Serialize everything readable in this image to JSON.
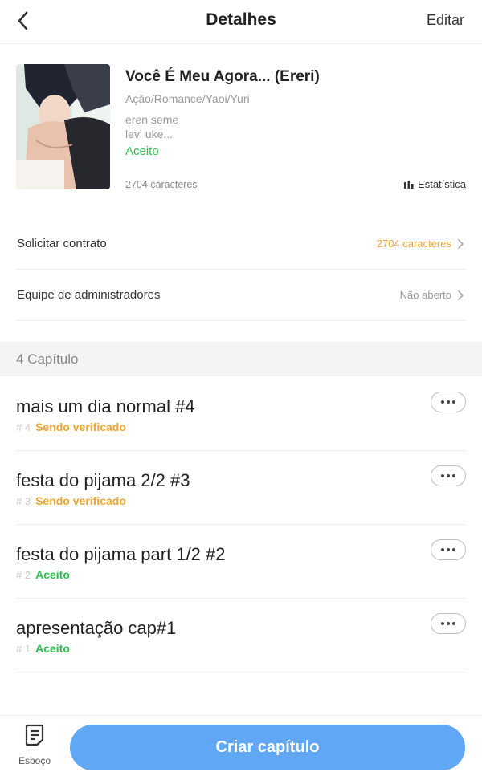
{
  "header": {
    "title": "Detalhes",
    "edit_label": "Editar"
  },
  "story": {
    "title": "Você É Meu Agora... (Ereri)",
    "genres": "Ação/Romance/Yaoi/Yuri",
    "desc_line1": "eren seme",
    "desc_line2": "levi uke...",
    "status": "Aceito",
    "chars": "2704 caracteres",
    "stats_label": "Estatística"
  },
  "rows": {
    "contract": {
      "label": "Solicitar contrato",
      "value": "2704 caracteres"
    },
    "admins": {
      "label": "Equipe de administradores",
      "value": "Não aberto"
    }
  },
  "chapters_header": "4 Capítulo",
  "chapters": [
    {
      "title": "mais um dia normal #4",
      "num": "# 4",
      "status": "Sendo verificado"
    },
    {
      "title": "festa do pijama 2/2 #3",
      "num": "# 3",
      "status": "Sendo verificado"
    },
    {
      "title": "festa do pijama part 1/2 #2",
      "num": "# 2",
      "status": "Aceito"
    },
    {
      "title": "apresentação cap#1",
      "num": "# 1",
      "status": "Aceito"
    }
  ],
  "bottom": {
    "draft_label": "Esboço",
    "create_label": "Criar capítulo"
  },
  "colors": {
    "accent_blue": "#60a7f5",
    "pending_orange": "#f0a52c",
    "accepted_green": "#2ec04f"
  }
}
